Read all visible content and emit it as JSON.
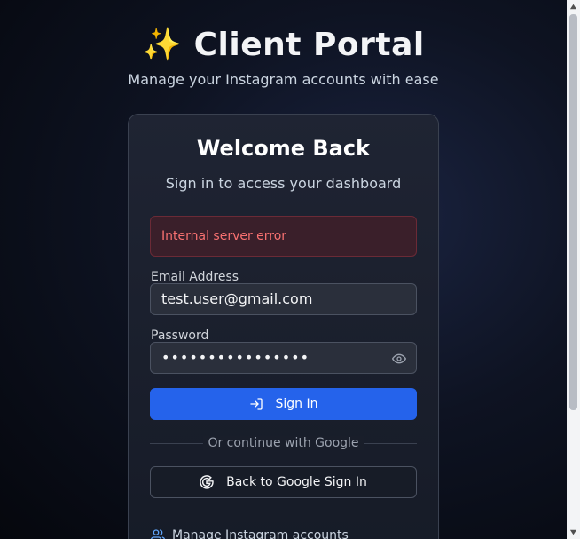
{
  "header": {
    "emoji": "✨",
    "title": "Client Portal",
    "subtitle": "Manage your Instagram accounts with ease"
  },
  "card": {
    "title": "Welcome Back",
    "subtitle": "Sign in to access your dashboard",
    "error": "Internal server error",
    "email": {
      "label": "Email Address",
      "value": "test.user@gmail.com"
    },
    "password": {
      "label": "Password",
      "masked_value": "••••••••••••••••",
      "toggle_icon": "eye-icon"
    },
    "sign_in_button": {
      "label": "Sign In",
      "icon": "login-icon"
    },
    "divider": "Or continue with Google",
    "google_button": {
      "label": "Back to Google Sign In",
      "icon": "google-icon"
    },
    "feature": {
      "label": "Manage Instagram accounts",
      "icon": "users-icon"
    }
  },
  "colors": {
    "primary": "#2563eb",
    "error_text": "#f87171",
    "error_bg": "#3a1f2a",
    "card_bg": "#1f2433",
    "page_bg": "#0e1322"
  }
}
